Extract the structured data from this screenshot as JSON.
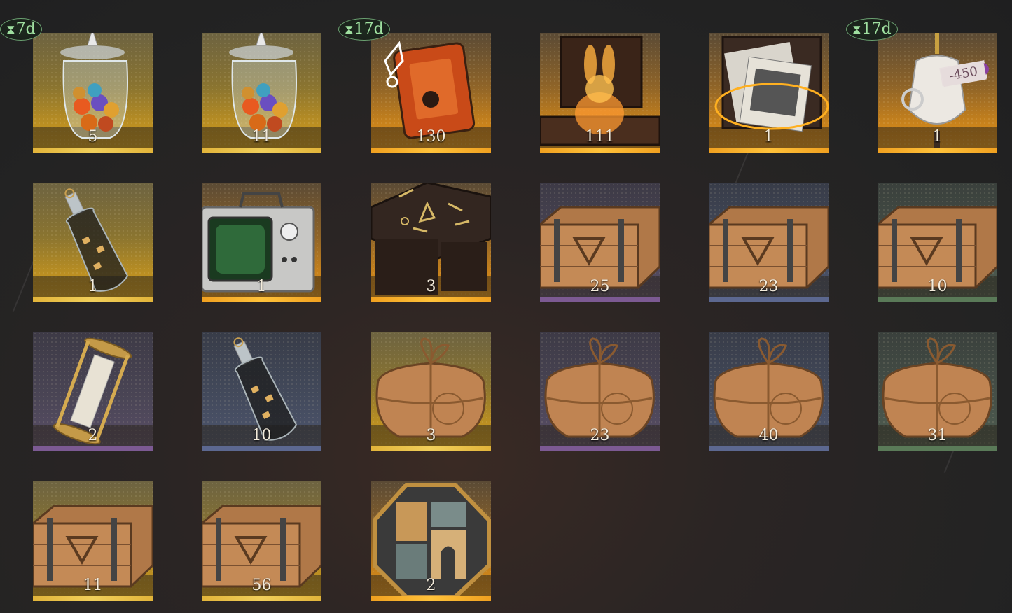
{
  "items": [
    {
      "name": "orb-jar-1",
      "count": "5",
      "rarity": "gold",
      "icon": "orb-jar-icon",
      "timer": "7d"
    },
    {
      "name": "orb-jar-2",
      "count": "11",
      "rarity": "gold",
      "icon": "orb-jar-icon",
      "timer": null
    },
    {
      "name": "rune-cassette",
      "count": "130",
      "rarity": "orange",
      "icon": "rune-cassette-icon",
      "timer": "17d"
    },
    {
      "name": "rabbit-chest",
      "count": "111",
      "rarity": "orange",
      "icon": "glowing-rabbit-chest-icon",
      "timer": null
    },
    {
      "name": "photo-chest",
      "count": "1",
      "rarity": "orange",
      "icon": "photo-chest-icon",
      "timer": null
    },
    {
      "name": "mannequin",
      "count": "1",
      "rarity": "orange",
      "icon": "mannequin-icon",
      "timer": "17d",
      "tag": "-450"
    },
    {
      "name": "message-bottle-gold",
      "count": "1",
      "rarity": "gold",
      "icon": "message-bottle-icon",
      "timer": null
    },
    {
      "name": "crt-radio",
      "count": "1",
      "rarity": "orange",
      "icon": "crt-radio-icon",
      "timer": null
    },
    {
      "name": "rune-box",
      "count": "3",
      "rarity": "orange",
      "icon": "rune-box-icon",
      "timer": null
    },
    {
      "name": "crate-purple",
      "count": "25",
      "rarity": "purple",
      "icon": "wooden-crate-icon",
      "timer": null
    },
    {
      "name": "crate-blue",
      "count": "23",
      "rarity": "blue",
      "icon": "wooden-crate-icon",
      "timer": null
    },
    {
      "name": "crate-green",
      "count": "10",
      "rarity": "green",
      "icon": "wooden-crate-icon",
      "timer": null
    },
    {
      "name": "hourglass-scroll",
      "count": "2",
      "rarity": "purple",
      "icon": "scroll-cage-icon",
      "timer": null
    },
    {
      "name": "message-bottle-blue",
      "count": "10",
      "rarity": "blue",
      "icon": "message-bottle-icon",
      "timer": null
    },
    {
      "name": "parcel-gold",
      "count": "3",
      "rarity": "gold",
      "icon": "parcel-icon",
      "timer": null
    },
    {
      "name": "parcel-purple",
      "count": "23",
      "rarity": "purple",
      "icon": "parcel-icon",
      "timer": null
    },
    {
      "name": "parcel-blue",
      "count": "40",
      "rarity": "blue",
      "icon": "parcel-icon",
      "timer": null
    },
    {
      "name": "parcel-green",
      "count": "31",
      "rarity": "green",
      "icon": "parcel-icon",
      "timer": null
    },
    {
      "name": "crate-gold-1",
      "count": "11",
      "rarity": "gold",
      "icon": "wooden-crate-icon",
      "timer": null
    },
    {
      "name": "crate-gold-2",
      "count": "56",
      "rarity": "gold",
      "icon": "wooden-crate-icon",
      "timer": null
    },
    {
      "name": "hex-puzzle",
      "count": "2",
      "rarity": "orange",
      "icon": "hex-puzzle-icon",
      "timer": null
    }
  ],
  "colors": {
    "gold": "#e2b43a",
    "orange": "#f0a020",
    "purple": "#7c5a93",
    "blue": "#5c6890",
    "green": "#5a7a58",
    "timer_text": "#9fe0a0"
  }
}
